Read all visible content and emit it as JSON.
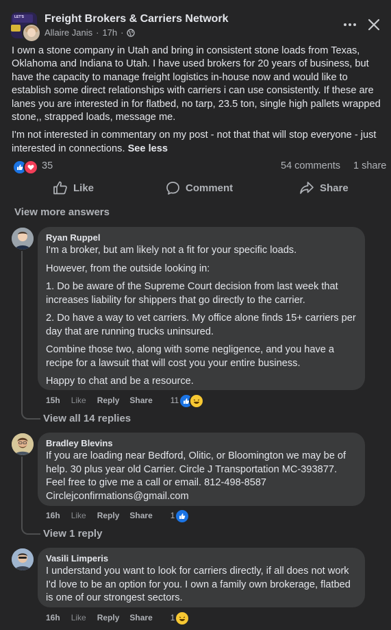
{
  "header": {
    "group_name": "Freight Brokers & Carriers Network",
    "author": "Allaire Janis",
    "separator": "·",
    "time": "17h",
    "group_avatar_label": "LET'S"
  },
  "post": {
    "paragraph1": "I own a stone company in Utah and bring in consistent stone loads from Texas, Oklahoma and Indiana to Utah. I have used brokers for 20 years of business, but have the capacity to manage freight logistics in-house now and would like to establish some direct relationships with carriers i can use consistently. If these are lanes you are interested in for flatbed, no tarp, 23.5 ton, single high pallets wrapped stone,, strapped loads, message me.",
    "paragraph2": "I'm not interested in commentary on my post - not that that will stop everyone - just interested in connections.",
    "see_less": "See less"
  },
  "stats": {
    "reaction_count": "35",
    "comments": "54 comments",
    "shares": "1 share"
  },
  "actions": {
    "like": "Like",
    "comment": "Comment",
    "share": "Share"
  },
  "view_more_answers": "View more answers",
  "comments": [
    {
      "name": "Ryan Ruppel",
      "paragraphs": [
        "I'm a broker, but am likely not a fit for your specific loads.",
        "However, from the outside looking in:",
        "1. Do be aware of the Supreme Court decision from last week that increases liability for shippers that go directly to the carrier.",
        "2. Do have a way to vet carriers. My office alone finds 15+ carriers per day that are running trucks uninsured.",
        "Combine those two, along with some negligence, and you have a recipe for a lawsuit that will cost you your entire business.",
        "Happy to chat and be a resource."
      ],
      "time": "15h",
      "like": "Like",
      "reply": "Reply",
      "share": "Share",
      "reactions": "11",
      "view_replies": "View all 14 replies"
    },
    {
      "name": "Bradley Blevins",
      "paragraphs": [
        "If you are loading near Bedford, Olitic, or Bloomington we may be of help. 30 plus year old Carrier. Circle J Transportation MC-393877. Feel free to give me a call or email. 812-498-8587 Circlejconfirmations@gmail.com"
      ],
      "time": "16h",
      "like": "Like",
      "reply": "Reply",
      "share": "Share",
      "reactions": "1",
      "view_replies": "View 1 reply"
    },
    {
      "name": "Vasili Limperis",
      "paragraphs": [
        "I understand you want to look for carriers directly, if all does not work I'd love to be an option for you. I own a family own brokerage, flatbed is one of our strongest sectors."
      ],
      "time": "16h",
      "like": "Like",
      "reply": "Reply",
      "share": "Share",
      "reactions": "1"
    }
  ],
  "colors": {
    "background": "#252526",
    "bubble": "#3a3b3c",
    "text_primary": "#e4e6eb",
    "text_secondary": "#b0b3b8",
    "like_blue": "#1b74e4",
    "love_red": "#f33e58",
    "haha_yellow": "#f7c833"
  }
}
